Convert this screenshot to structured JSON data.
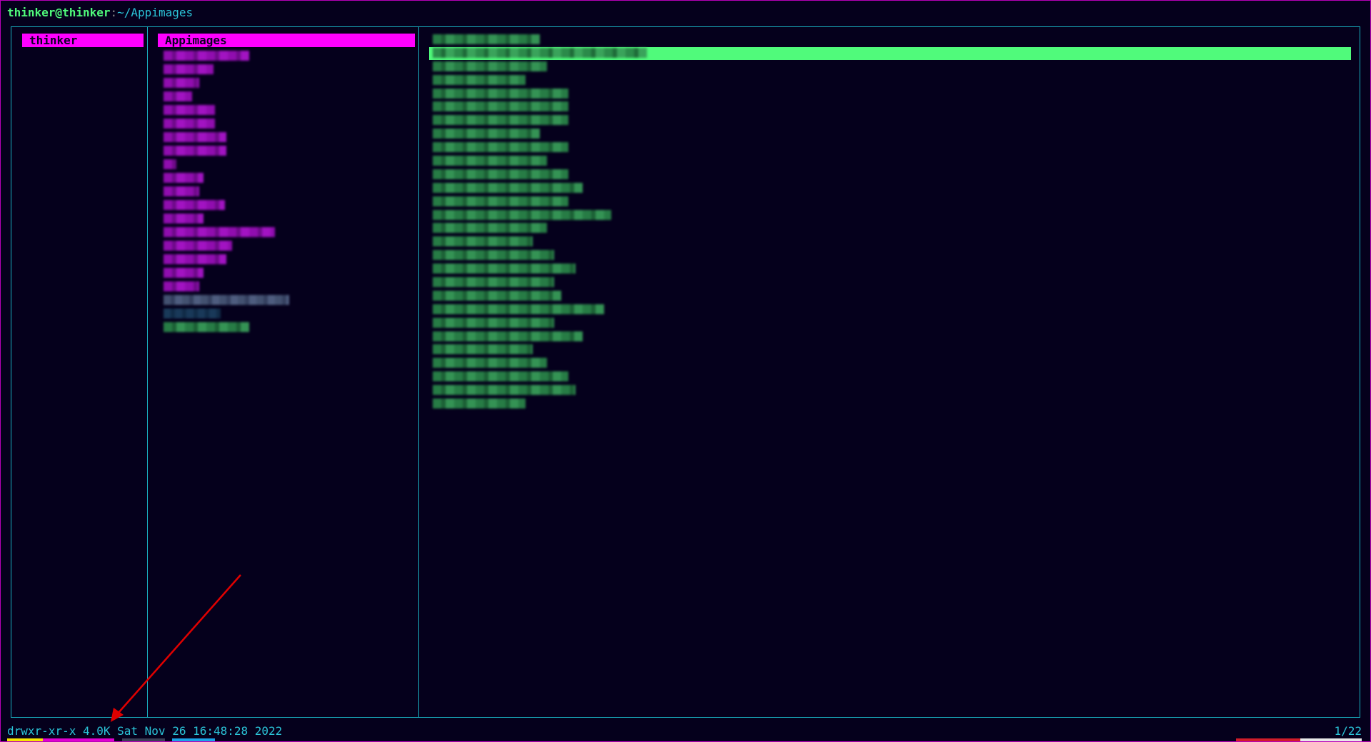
{
  "titlebar": {
    "user_host": "thinker@thinker",
    "separator": ":",
    "path": "~/Appimages"
  },
  "columns": {
    "parent_dir": "thinker",
    "current_dir": "Appimages"
  },
  "status": {
    "file_info": "drwxr-xr-x 4.0K Sat Nov 26 16:48:28 2022",
    "position": "1/22"
  },
  "colors": {
    "accent_magenta": "#ff00ff",
    "border_cyan": "#19b3c2",
    "selection_green": "#50fa7b",
    "background": "#05001c",
    "annotation_arrow": "#e00000"
  },
  "annotation": {
    "type": "arrow",
    "points_to": "status-file-info"
  }
}
